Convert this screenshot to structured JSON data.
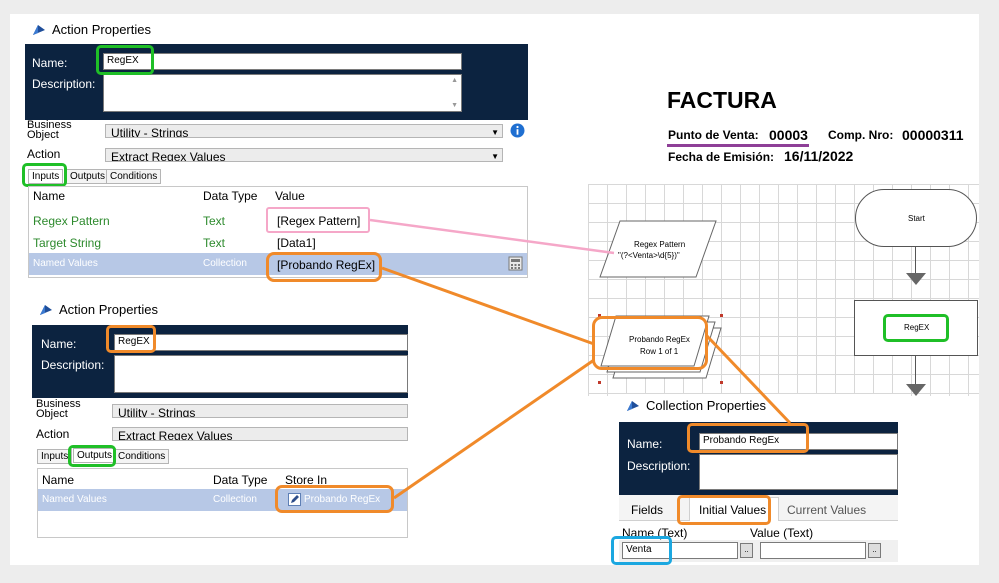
{
  "ap1": {
    "title": "Action Properties",
    "name_label": "Name:",
    "name_value": "RegEX",
    "description_label": "Description:",
    "business_object_label": "Business Object",
    "business_object_value": "Utility - Strings",
    "action_label": "Action",
    "action_value": "Extract Regex Values",
    "tabs": [
      "Inputs",
      "Outputs",
      "Conditions"
    ],
    "columns": [
      "Name",
      "Data Type",
      "Value"
    ],
    "rows": [
      {
        "name": "Regex Pattern",
        "type": "Text",
        "value": "[Regex Pattern]"
      },
      {
        "name": "Target String",
        "type": "Text",
        "value": "[Data1]"
      },
      {
        "name": "Named Values",
        "type": "Collection",
        "value": "[Probando RegEx]"
      }
    ]
  },
  "ap2": {
    "title": "Action Properties",
    "name_label": "Name:",
    "name_value": "RegEX",
    "description_label": "Description:",
    "business_object_label": "Business Object",
    "business_object_value": "Utility - Strings",
    "action_label": "Action",
    "action_value": "Extract Regex Values",
    "tabs": [
      "Inputs",
      "Outputs",
      "Conditions"
    ],
    "columns": [
      "Name",
      "Data Type",
      "Store In"
    ],
    "row": {
      "name": "Named Values",
      "type": "Collection",
      "value": "Probando RegEx"
    }
  },
  "invoice": {
    "title": "FACTURA",
    "pv_label": "Punto de Venta:",
    "pv_value": "00003",
    "comp_label": "Comp. Nro:",
    "comp_value": "00000311",
    "date_label": "Fecha de Emisión:",
    "date_value": "16/11/2022"
  },
  "flow": {
    "regex_shape_line1": "Regex Pattern",
    "regex_shape_line2": "\"(?<Venta>\\d{5})\"",
    "collection_line1": "Probando RegEx",
    "collection_line2": "Row 1 of 1",
    "start_label": "Start",
    "action_label": "RegEX"
  },
  "cp": {
    "title": "Collection Properties",
    "name_label": "Name:",
    "name_value": "Probando RegEx",
    "description_label": "Description:",
    "tabs": [
      "Fields",
      "Initial Values",
      "Current Values"
    ],
    "columns": [
      "Name (Text)",
      "Value (Text)"
    ],
    "cell_name": "Venta",
    "cell_value": "",
    "ellipsis": ".."
  },
  "colors": {
    "navy": "#0c2340",
    "green": "#1fbf27",
    "orange": "#f08a2a",
    "pink": "#f5a7c8",
    "blue": "#1ba7e0",
    "purple": "#8e3f97",
    "selected_row": "#b7c8e6",
    "text_green": "#2d8a2d"
  }
}
